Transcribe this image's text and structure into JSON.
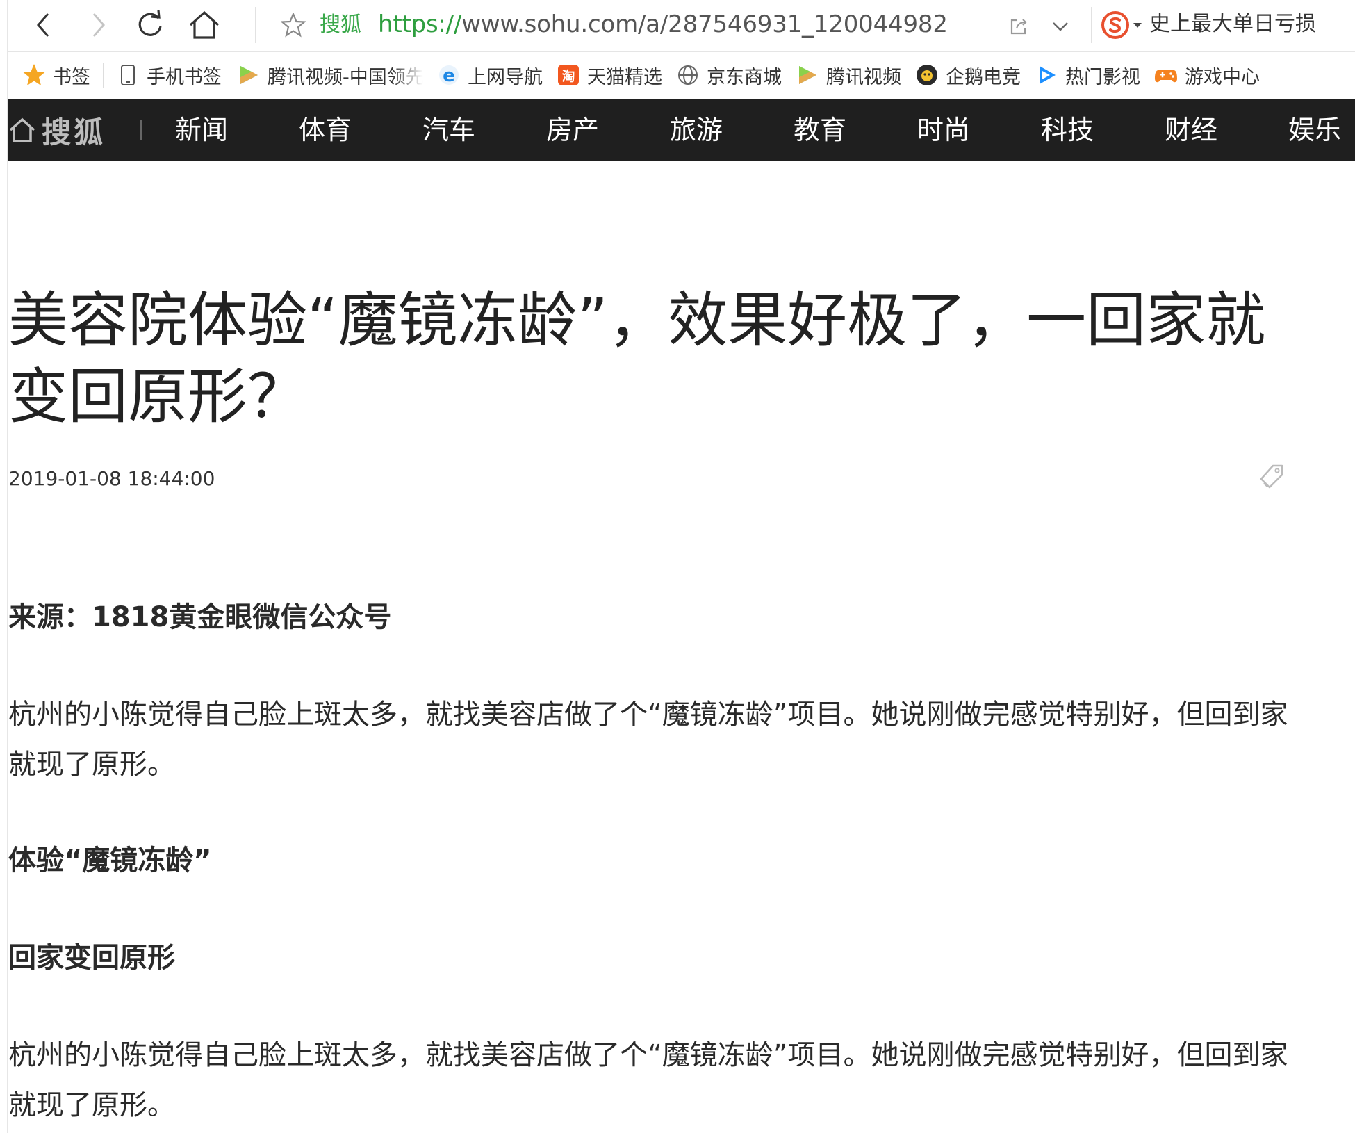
{
  "browser": {
    "address_bar": {
      "site_name": "搜狐",
      "url_protocol": "https://",
      "url_rest": "www.sohu.com/a/287546931_120044982",
      "hot_search": "史上最大单日亏损"
    },
    "bookmarks": [
      {
        "label": "书签",
        "icon": "star-icon"
      },
      {
        "label": "手机书签",
        "icon": "phone-icon"
      },
      {
        "label": "腾讯视频-中国领先",
        "icon": "tencent-video-icon"
      },
      {
        "label": "上网导航",
        "icon": "ie-icon"
      },
      {
        "label": "天猫精选",
        "icon": "taobao-icon"
      },
      {
        "label": "京东商城",
        "icon": "globe-icon"
      },
      {
        "label": "腾讯视频",
        "icon": "tencent-video-icon"
      },
      {
        "label": "企鹅电竞",
        "icon": "penguin-esports-icon"
      },
      {
        "label": "热门影视",
        "icon": "play-icon"
      },
      {
        "label": "游戏中心",
        "icon": "gamepad-icon"
      }
    ]
  },
  "site": {
    "logo_text": "搜狐",
    "nav": [
      "新闻",
      "体育",
      "汽车",
      "房产",
      "旅游",
      "教育",
      "时尚",
      "科技",
      "财经",
      "娱乐"
    ]
  },
  "article": {
    "title": "美容院体验“魔镜冻龄”，效果好极了，一回家就变回原形？",
    "date": "2019-01-08 18:44:00",
    "source": "来源：1818黄金眼微信公众号",
    "para1": "杭州的小陈觉得自己脸上斑太多，就找美容店做了个“魔镜冻龄”项目。她说刚做完感觉特别好，但回到家就现了原形。",
    "heading1": "体验“魔镜冻龄”",
    "heading2": "回家变回原形",
    "para2": "杭州的小陈觉得自己脸上斑太多，就找美容店做了个“魔镜冻龄”项目。她说刚做完感觉特别好，但回到家就现了原形。"
  },
  "colors": {
    "nav_background": "#1f1f1f",
    "url_green": "#2e9e3f",
    "bookmark_star": "#f5a623",
    "sogou_red": "#e8502f"
  }
}
